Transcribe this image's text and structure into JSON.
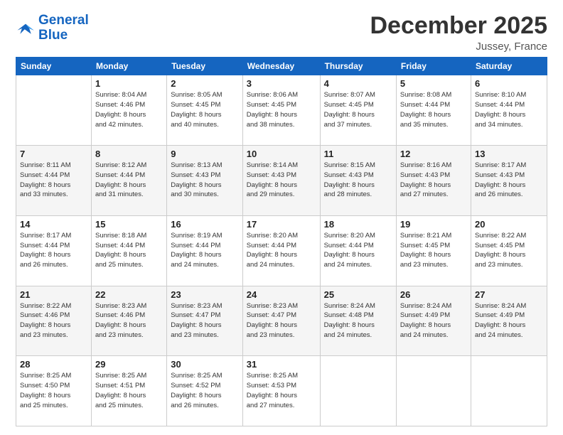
{
  "logo": {
    "line1": "General",
    "line2": "Blue"
  },
  "title": "December 2025",
  "subtitle": "Jussey, France",
  "days_of_week": [
    "Sunday",
    "Monday",
    "Tuesday",
    "Wednesday",
    "Thursday",
    "Friday",
    "Saturday"
  ],
  "weeks": [
    [
      {
        "day": "",
        "info": ""
      },
      {
        "day": "1",
        "info": "Sunrise: 8:04 AM\nSunset: 4:46 PM\nDaylight: 8 hours\nand 42 minutes."
      },
      {
        "day": "2",
        "info": "Sunrise: 8:05 AM\nSunset: 4:45 PM\nDaylight: 8 hours\nand 40 minutes."
      },
      {
        "day": "3",
        "info": "Sunrise: 8:06 AM\nSunset: 4:45 PM\nDaylight: 8 hours\nand 38 minutes."
      },
      {
        "day": "4",
        "info": "Sunrise: 8:07 AM\nSunset: 4:45 PM\nDaylight: 8 hours\nand 37 minutes."
      },
      {
        "day": "5",
        "info": "Sunrise: 8:08 AM\nSunset: 4:44 PM\nDaylight: 8 hours\nand 35 minutes."
      },
      {
        "day": "6",
        "info": "Sunrise: 8:10 AM\nSunset: 4:44 PM\nDaylight: 8 hours\nand 34 minutes."
      }
    ],
    [
      {
        "day": "7",
        "info": "Sunrise: 8:11 AM\nSunset: 4:44 PM\nDaylight: 8 hours\nand 33 minutes."
      },
      {
        "day": "8",
        "info": "Sunrise: 8:12 AM\nSunset: 4:44 PM\nDaylight: 8 hours\nand 31 minutes."
      },
      {
        "day": "9",
        "info": "Sunrise: 8:13 AM\nSunset: 4:43 PM\nDaylight: 8 hours\nand 30 minutes."
      },
      {
        "day": "10",
        "info": "Sunrise: 8:14 AM\nSunset: 4:43 PM\nDaylight: 8 hours\nand 29 minutes."
      },
      {
        "day": "11",
        "info": "Sunrise: 8:15 AM\nSunset: 4:43 PM\nDaylight: 8 hours\nand 28 minutes."
      },
      {
        "day": "12",
        "info": "Sunrise: 8:16 AM\nSunset: 4:43 PM\nDaylight: 8 hours\nand 27 minutes."
      },
      {
        "day": "13",
        "info": "Sunrise: 8:17 AM\nSunset: 4:43 PM\nDaylight: 8 hours\nand 26 minutes."
      }
    ],
    [
      {
        "day": "14",
        "info": "Sunrise: 8:17 AM\nSunset: 4:44 PM\nDaylight: 8 hours\nand 26 minutes."
      },
      {
        "day": "15",
        "info": "Sunrise: 8:18 AM\nSunset: 4:44 PM\nDaylight: 8 hours\nand 25 minutes."
      },
      {
        "day": "16",
        "info": "Sunrise: 8:19 AM\nSunset: 4:44 PM\nDaylight: 8 hours\nand 24 minutes."
      },
      {
        "day": "17",
        "info": "Sunrise: 8:20 AM\nSunset: 4:44 PM\nDaylight: 8 hours\nand 24 minutes."
      },
      {
        "day": "18",
        "info": "Sunrise: 8:20 AM\nSunset: 4:44 PM\nDaylight: 8 hours\nand 24 minutes."
      },
      {
        "day": "19",
        "info": "Sunrise: 8:21 AM\nSunset: 4:45 PM\nDaylight: 8 hours\nand 23 minutes."
      },
      {
        "day": "20",
        "info": "Sunrise: 8:22 AM\nSunset: 4:45 PM\nDaylight: 8 hours\nand 23 minutes."
      }
    ],
    [
      {
        "day": "21",
        "info": "Sunrise: 8:22 AM\nSunset: 4:46 PM\nDaylight: 8 hours\nand 23 minutes."
      },
      {
        "day": "22",
        "info": "Sunrise: 8:23 AM\nSunset: 4:46 PM\nDaylight: 8 hours\nand 23 minutes."
      },
      {
        "day": "23",
        "info": "Sunrise: 8:23 AM\nSunset: 4:47 PM\nDaylight: 8 hours\nand 23 minutes."
      },
      {
        "day": "24",
        "info": "Sunrise: 8:23 AM\nSunset: 4:47 PM\nDaylight: 8 hours\nand 23 minutes."
      },
      {
        "day": "25",
        "info": "Sunrise: 8:24 AM\nSunset: 4:48 PM\nDaylight: 8 hours\nand 24 minutes."
      },
      {
        "day": "26",
        "info": "Sunrise: 8:24 AM\nSunset: 4:49 PM\nDaylight: 8 hours\nand 24 minutes."
      },
      {
        "day": "27",
        "info": "Sunrise: 8:24 AM\nSunset: 4:49 PM\nDaylight: 8 hours\nand 24 minutes."
      }
    ],
    [
      {
        "day": "28",
        "info": "Sunrise: 8:25 AM\nSunset: 4:50 PM\nDaylight: 8 hours\nand 25 minutes."
      },
      {
        "day": "29",
        "info": "Sunrise: 8:25 AM\nSunset: 4:51 PM\nDaylight: 8 hours\nand 25 minutes."
      },
      {
        "day": "30",
        "info": "Sunrise: 8:25 AM\nSunset: 4:52 PM\nDaylight: 8 hours\nand 26 minutes."
      },
      {
        "day": "31",
        "info": "Sunrise: 8:25 AM\nSunset: 4:53 PM\nDaylight: 8 hours\nand 27 minutes."
      },
      {
        "day": "",
        "info": ""
      },
      {
        "day": "",
        "info": ""
      },
      {
        "day": "",
        "info": ""
      }
    ]
  ]
}
